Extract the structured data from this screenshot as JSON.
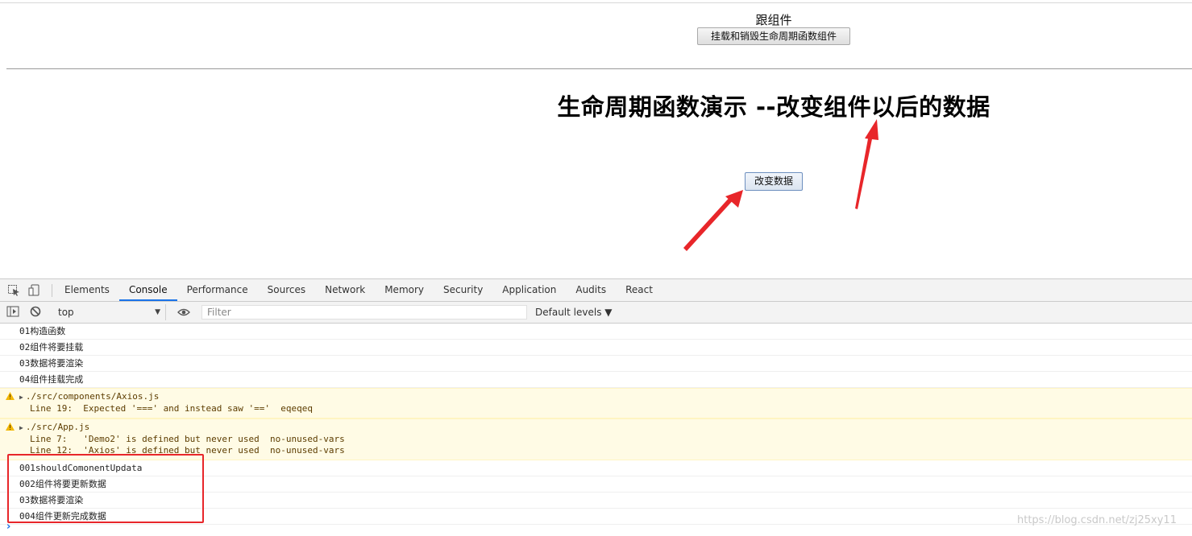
{
  "page": {
    "root_label": "跟组件",
    "mount_button": "挂载和销毁生命周期函数组件",
    "headline": "生命周期函数演示 --改变组件以后的数据",
    "change_button": "改变数据"
  },
  "devtools": {
    "tabs": [
      "Elements",
      "Console",
      "Performance",
      "Sources",
      "Network",
      "Memory",
      "Security",
      "Application",
      "Audits",
      "React"
    ],
    "active_tab": "Console",
    "context": "top",
    "filter_placeholder": "Filter",
    "levels": "Default levels ▼"
  },
  "console": {
    "logs_before": [
      "01构造函数",
      "02组件将要挂载",
      "03数据将要渲染",
      "04组件挂载完成"
    ],
    "warnings": [
      {
        "file": "./src/components/Axios.js",
        "lines": [
          "Line 19:  Expected '===' and instead saw '=='  eqeqeq"
        ]
      },
      {
        "file": "./src/App.js",
        "lines": [
          "Line 7:   'Demo2' is defined but never used  no-unused-vars",
          "Line 12:  'Axios' is defined but never used  no-unused-vars"
        ]
      }
    ],
    "logs_after": [
      "001shouldComonentUpdata",
      "002组件将要更新数据",
      "03数据将要渲染",
      "004组件更新完成数据"
    ],
    "prompt": "›"
  },
  "watermark": "https://blog.csdn.net/zj25xy11",
  "colors": {
    "annotation_red": "#e8262a",
    "active_tab": "#1a73e8",
    "warning_bg": "#fffbe5"
  }
}
